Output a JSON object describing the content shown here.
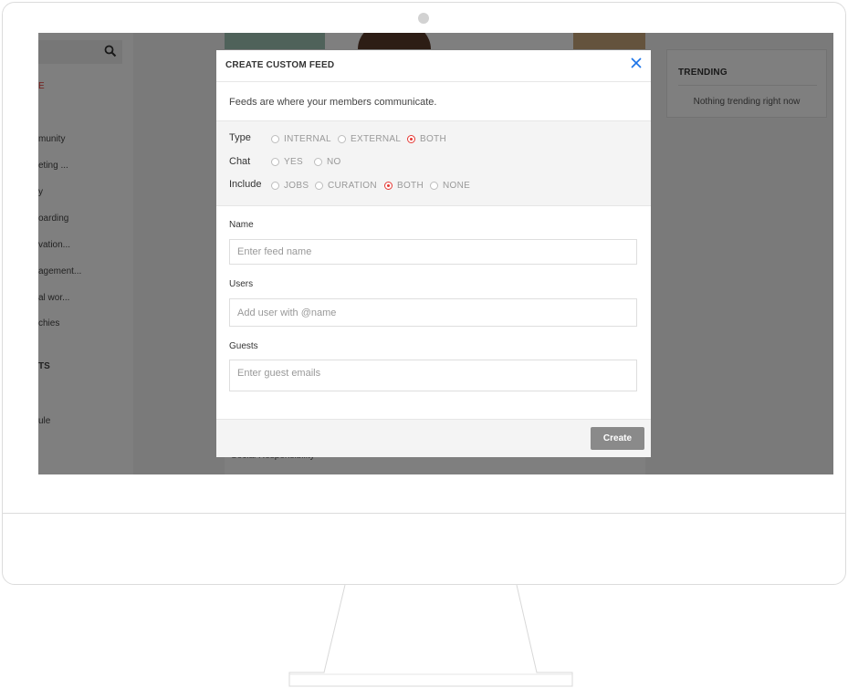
{
  "background": {
    "sidebar": {
      "items": [
        {
          "label": "E",
          "style": "accent"
        },
        {
          "label": "munity",
          "style": ""
        },
        {
          "label": "eting ...",
          "style": ""
        },
        {
          "label": "y",
          "style": ""
        },
        {
          "label": "oarding",
          "style": ""
        },
        {
          "label": "vation...",
          "style": ""
        },
        {
          "label": "agement...",
          "style": ""
        },
        {
          "label": "al wor...",
          "style": ""
        },
        {
          "label": "chies",
          "style": ""
        },
        {
          "label": "TS",
          "style": "bold"
        },
        {
          "label": "ule",
          "style": ""
        }
      ]
    },
    "main": {
      "footer_text": "Social Responsibility"
    },
    "trending": {
      "title": "TRENDING",
      "empty_text": "Nothing trending right now"
    }
  },
  "modal": {
    "title": "CREATE CUSTOM FEED",
    "description": "Feeds are where your members communicate.",
    "type": {
      "label": "Type",
      "options": [
        "INTERNAL",
        "EXTERNAL",
        "BOTH"
      ],
      "selected": "BOTH"
    },
    "chat": {
      "label": "Chat",
      "options": [
        "YES",
        "NO"
      ],
      "selected": ""
    },
    "include": {
      "label": "Include",
      "options": [
        "JOBS",
        "CURATION",
        "BOTH",
        "NONE"
      ],
      "selected": "BOTH"
    },
    "name": {
      "label": "Name",
      "placeholder": "Enter feed name",
      "value": ""
    },
    "users": {
      "label": "Users",
      "placeholder": "Add user with @name",
      "value": ""
    },
    "guests": {
      "label": "Guests",
      "placeholder": "Enter guest emails",
      "value": ""
    },
    "create_label": "Create"
  },
  "colors": {
    "accent": "#e53935",
    "close_icon": "#1a73e8",
    "button": "#8a8a8a",
    "overlay": "rgba(0,0,0,0.5)"
  }
}
